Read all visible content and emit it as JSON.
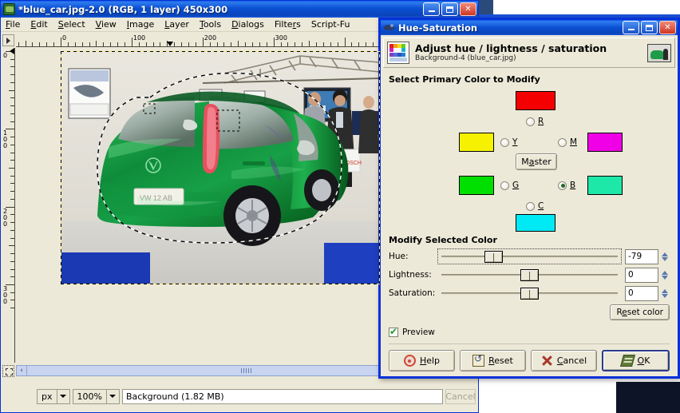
{
  "app": {
    "window_title": "*blue_car.jpg-2.0 (RGB, 1 layer) 450x300",
    "icon": "gimp-wilber-icon",
    "window_buttons": {
      "minimize": "minimize-icon",
      "maximize": "maximize-icon",
      "close": "close-icon"
    }
  },
  "menu": {
    "items": [
      {
        "label": "File",
        "mnemonic": "F"
      },
      {
        "label": "Edit",
        "mnemonic": "E"
      },
      {
        "label": "Select",
        "mnemonic": "S"
      },
      {
        "label": "View",
        "mnemonic": "V"
      },
      {
        "label": "Image",
        "mnemonic": "I"
      },
      {
        "label": "Layer",
        "mnemonic": "L"
      },
      {
        "label": "Tools",
        "mnemonic": "T"
      },
      {
        "label": "Dialogs",
        "mnemonic": "D"
      },
      {
        "label": "Filters",
        "mnemonic": "r"
      },
      {
        "label": "Script-Fu",
        "mnemonic": ""
      }
    ]
  },
  "rulers": {
    "unit": "px",
    "horizontal_labels": [
      "0",
      "100",
      "200",
      "300"
    ],
    "vertical_labels": [
      "0",
      "100",
      "200",
      "300"
    ]
  },
  "canvas": {
    "image_name": "blue_car.jpg",
    "image_size": "450x300",
    "selection": "free-select-marching-ants",
    "description": "Photograph of a green compact car on a motor-show stand with visitors"
  },
  "statusbar": {
    "unit_value": "px",
    "zoom_value": "100%",
    "status_text": "Background (1.82 MB)",
    "cancel_label": "Cancel",
    "quickmask_icon": "quick-mask-icon",
    "navigate_icon": "navigate-arrow-icon"
  },
  "dialog": {
    "title": "Hue-Saturation",
    "icon": "hue-saturation-icon",
    "window_buttons": {
      "minimize": "minimize-icon",
      "maximize": "maximize-icon",
      "close": "close-icon"
    },
    "header": {
      "heading": "Adjust hue / lightness / saturation",
      "subheading": "Background-4 (blue_car.jpg)",
      "icon": "color-adjust-icon",
      "thumbnail": "layer-preview-thumbnail"
    },
    "primary_color_section": {
      "label": "Select Primary Color to Modify",
      "master_label": "Master",
      "master_mnemonic": "a",
      "channels": [
        {
          "id": "R",
          "label": "R",
          "color": "#f40000",
          "selected": false
        },
        {
          "id": "Y",
          "label": "Y",
          "color": "#f6f100",
          "selected": false
        },
        {
          "id": "M",
          "label": "M",
          "color": "#f000e6",
          "selected": false
        },
        {
          "id": "G",
          "label": "G",
          "color": "#00e000",
          "selected": false
        },
        {
          "id": "B",
          "label": "B",
          "color": "#1ee8a8",
          "selected": true
        },
        {
          "id": "C",
          "label": "C",
          "color": "#00eaf6",
          "selected": false
        }
      ]
    },
    "modify_section": {
      "label": "Modify Selected Color",
      "sliders": [
        {
          "name": "Hue:",
          "mnemonic": "H",
          "value": "-79",
          "min": -180,
          "max": 180,
          "focused": true
        },
        {
          "name": "Lightness:",
          "mnemonic": "L",
          "value": "0",
          "min": -100,
          "max": 100,
          "focused": false
        },
        {
          "name": "Saturation:",
          "mnemonic": "S",
          "value": "0",
          "min": -100,
          "max": 100,
          "focused": false
        }
      ],
      "reset_color_label": "Reset color",
      "reset_color_mnemonic": "e"
    },
    "preview": {
      "label": "Preview",
      "checked": true
    },
    "buttons": [
      {
        "label": "Help",
        "icon": "help-icon",
        "mnemonic": "H",
        "default": false
      },
      {
        "label": "Reset",
        "icon": "reset-icon",
        "mnemonic": "R",
        "default": false
      },
      {
        "label": "Cancel",
        "icon": "cancel-icon",
        "mnemonic": "C",
        "default": false
      },
      {
        "label": "OK",
        "icon": "ok-icon",
        "mnemonic": "O",
        "default": true
      }
    ]
  }
}
